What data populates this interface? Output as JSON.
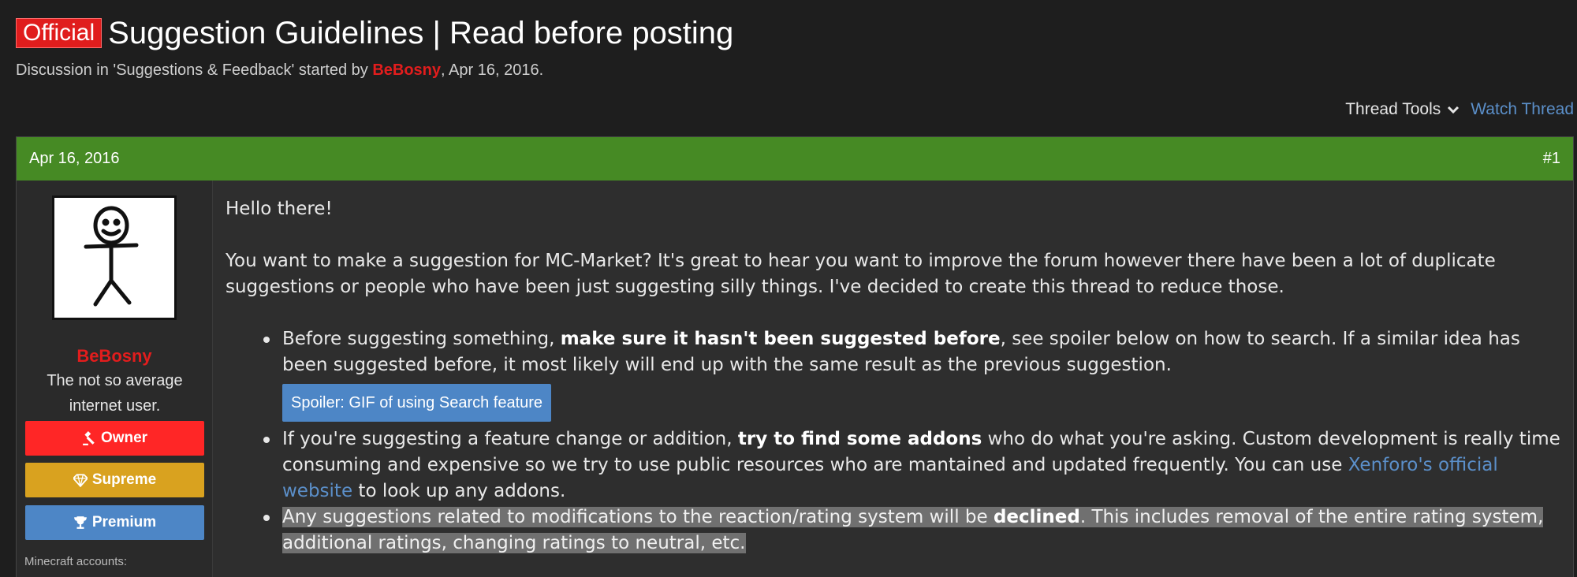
{
  "thread": {
    "prefix": "Official",
    "title": "Suggestion Guidelines | Read before posting",
    "subtitle_prefix": "Discussion in 'Suggestions & Feedback' started by ",
    "author": "BeBosny",
    "subtitle_suffix": ", Apr 16, 2016."
  },
  "tools": {
    "thread_tools": "Thread Tools",
    "watch_thread": "Watch Thread"
  },
  "post": {
    "date": "Apr 16, 2016",
    "number": "#1",
    "user": {
      "name": "BeBosny",
      "title": "The not so average internet user.",
      "banners": [
        "Owner",
        "Supreme",
        "Premium"
      ],
      "extra_label": "Minecraft accounts:"
    },
    "message": {
      "greeting": "Hello there!",
      "intro": "You want to make a suggestion for MC-Market? It's great to hear you want to improve the forum however there have been a lot of duplicate suggestions or people who have been just suggesting silly things. I've decided to create this thread to reduce those.",
      "bullet1_a": "Before suggesting something, ",
      "bullet1_b": "make sure it hasn't been suggested before",
      "bullet1_c": ", see spoiler below on how to search. If a similar idea has been suggested before, it most likely will end up with the same result as the previous suggestion.",
      "spoiler_label": "Spoiler: GIF of using Search feature",
      "bullet2_a": "If you're suggesting a feature change or addition, ",
      "bullet2_b": "try to find some addons",
      "bullet2_c": " who do what you're asking. Custom development is really time consuming and expensive so we try to use public resources who are mantained and updated frequently. You can use ",
      "bullet2_link": "Xenforo's official website",
      "bullet2_d": " to look up any addons.",
      "bullet3_a": "Any suggestions related to modifications to the reaction/rating system will be ",
      "bullet3_b": "declined",
      "bullet3_c": ". This includes removal of the entire rating system, additional ratings, changing ratings to neutral, etc."
    }
  },
  "colors": {
    "header_green": "#468a24",
    "brand_red": "#e21d1d",
    "link_blue": "#5b8fc9",
    "owner_red": "#ff2626",
    "supreme_gold": "#d9a21f",
    "premium_blue": "#4d86c6"
  }
}
